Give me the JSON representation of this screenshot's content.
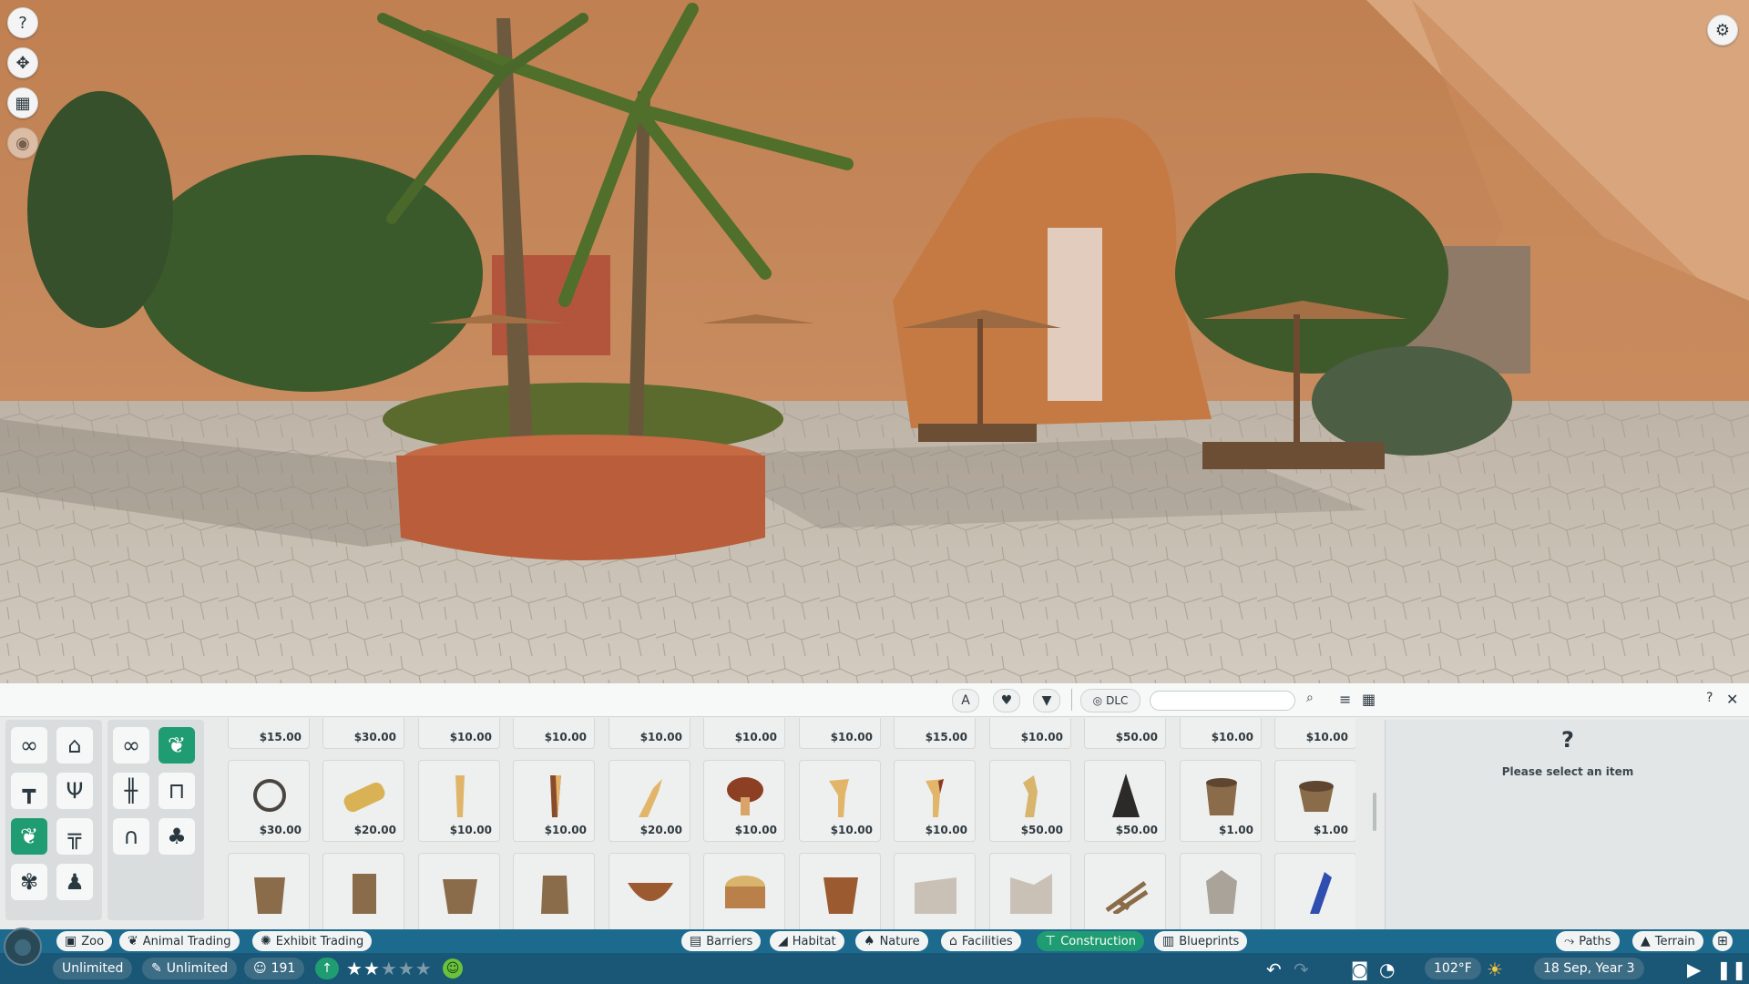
{
  "scene": {
    "top_icons": [
      "help-icon",
      "animal-icon",
      "calendar-icon",
      "visibility-icon"
    ],
    "settings_icon": "gear-icon"
  },
  "toolbar": {
    "dlc_label": "DLC",
    "search": {
      "value": "",
      "placeholder": ""
    }
  },
  "categories": {
    "left": [
      "infinity-icon",
      "building-icon",
      "signpost-icon",
      "lamp-icon",
      "nature-icon",
      "table-icon",
      "plant-icon",
      "animal-icon"
    ],
    "right": [
      "infinity-icon",
      "leaf-icon",
      "fence-icon",
      "banner-icon",
      "arch-icon",
      "tree-icon"
    ],
    "active": "leaf-icon"
  },
  "items": {
    "row1": [
      "$15.00",
      "$30.00",
      "$10.00",
      "$10.00",
      "$10.00",
      "$10.00",
      "$10.00",
      "$15.00",
      "$10.00",
      "$50.00",
      "$10.00",
      "$10.00"
    ],
    "row2": [
      "$30.00",
      "$20.00",
      "$10.00",
      "$10.00",
      "$20.00",
      "$10.00",
      "$10.00",
      "$10.00",
      "$50.00",
      "$50.00",
      "$1.00",
      "$1.00"
    ],
    "row3_count": 12
  },
  "info": {
    "question": "?",
    "message": "Please select an item"
  },
  "nav": {
    "zoo": "Zoo",
    "animal_trading": "Animal Trading",
    "exhibit_trading": "Exhibit Trading",
    "barriers": "Barriers",
    "habitat": "Habitat",
    "nature": "Nature",
    "facilities": "Facilities",
    "construction": "Construction",
    "blueprints": "Blueprints",
    "paths": "Paths",
    "terrain": "Terrain"
  },
  "status": {
    "money": "Unlimited",
    "research": "Unlimited",
    "guests": "191",
    "rating_stars": 2,
    "rating_max": 5,
    "temperature": "102°F",
    "date": "18 Sep, Year 3"
  },
  "colors": {
    "accent": "#1f9c71",
    "nav_bar": "#1c6a8d",
    "status_bar": "#1a5675"
  }
}
